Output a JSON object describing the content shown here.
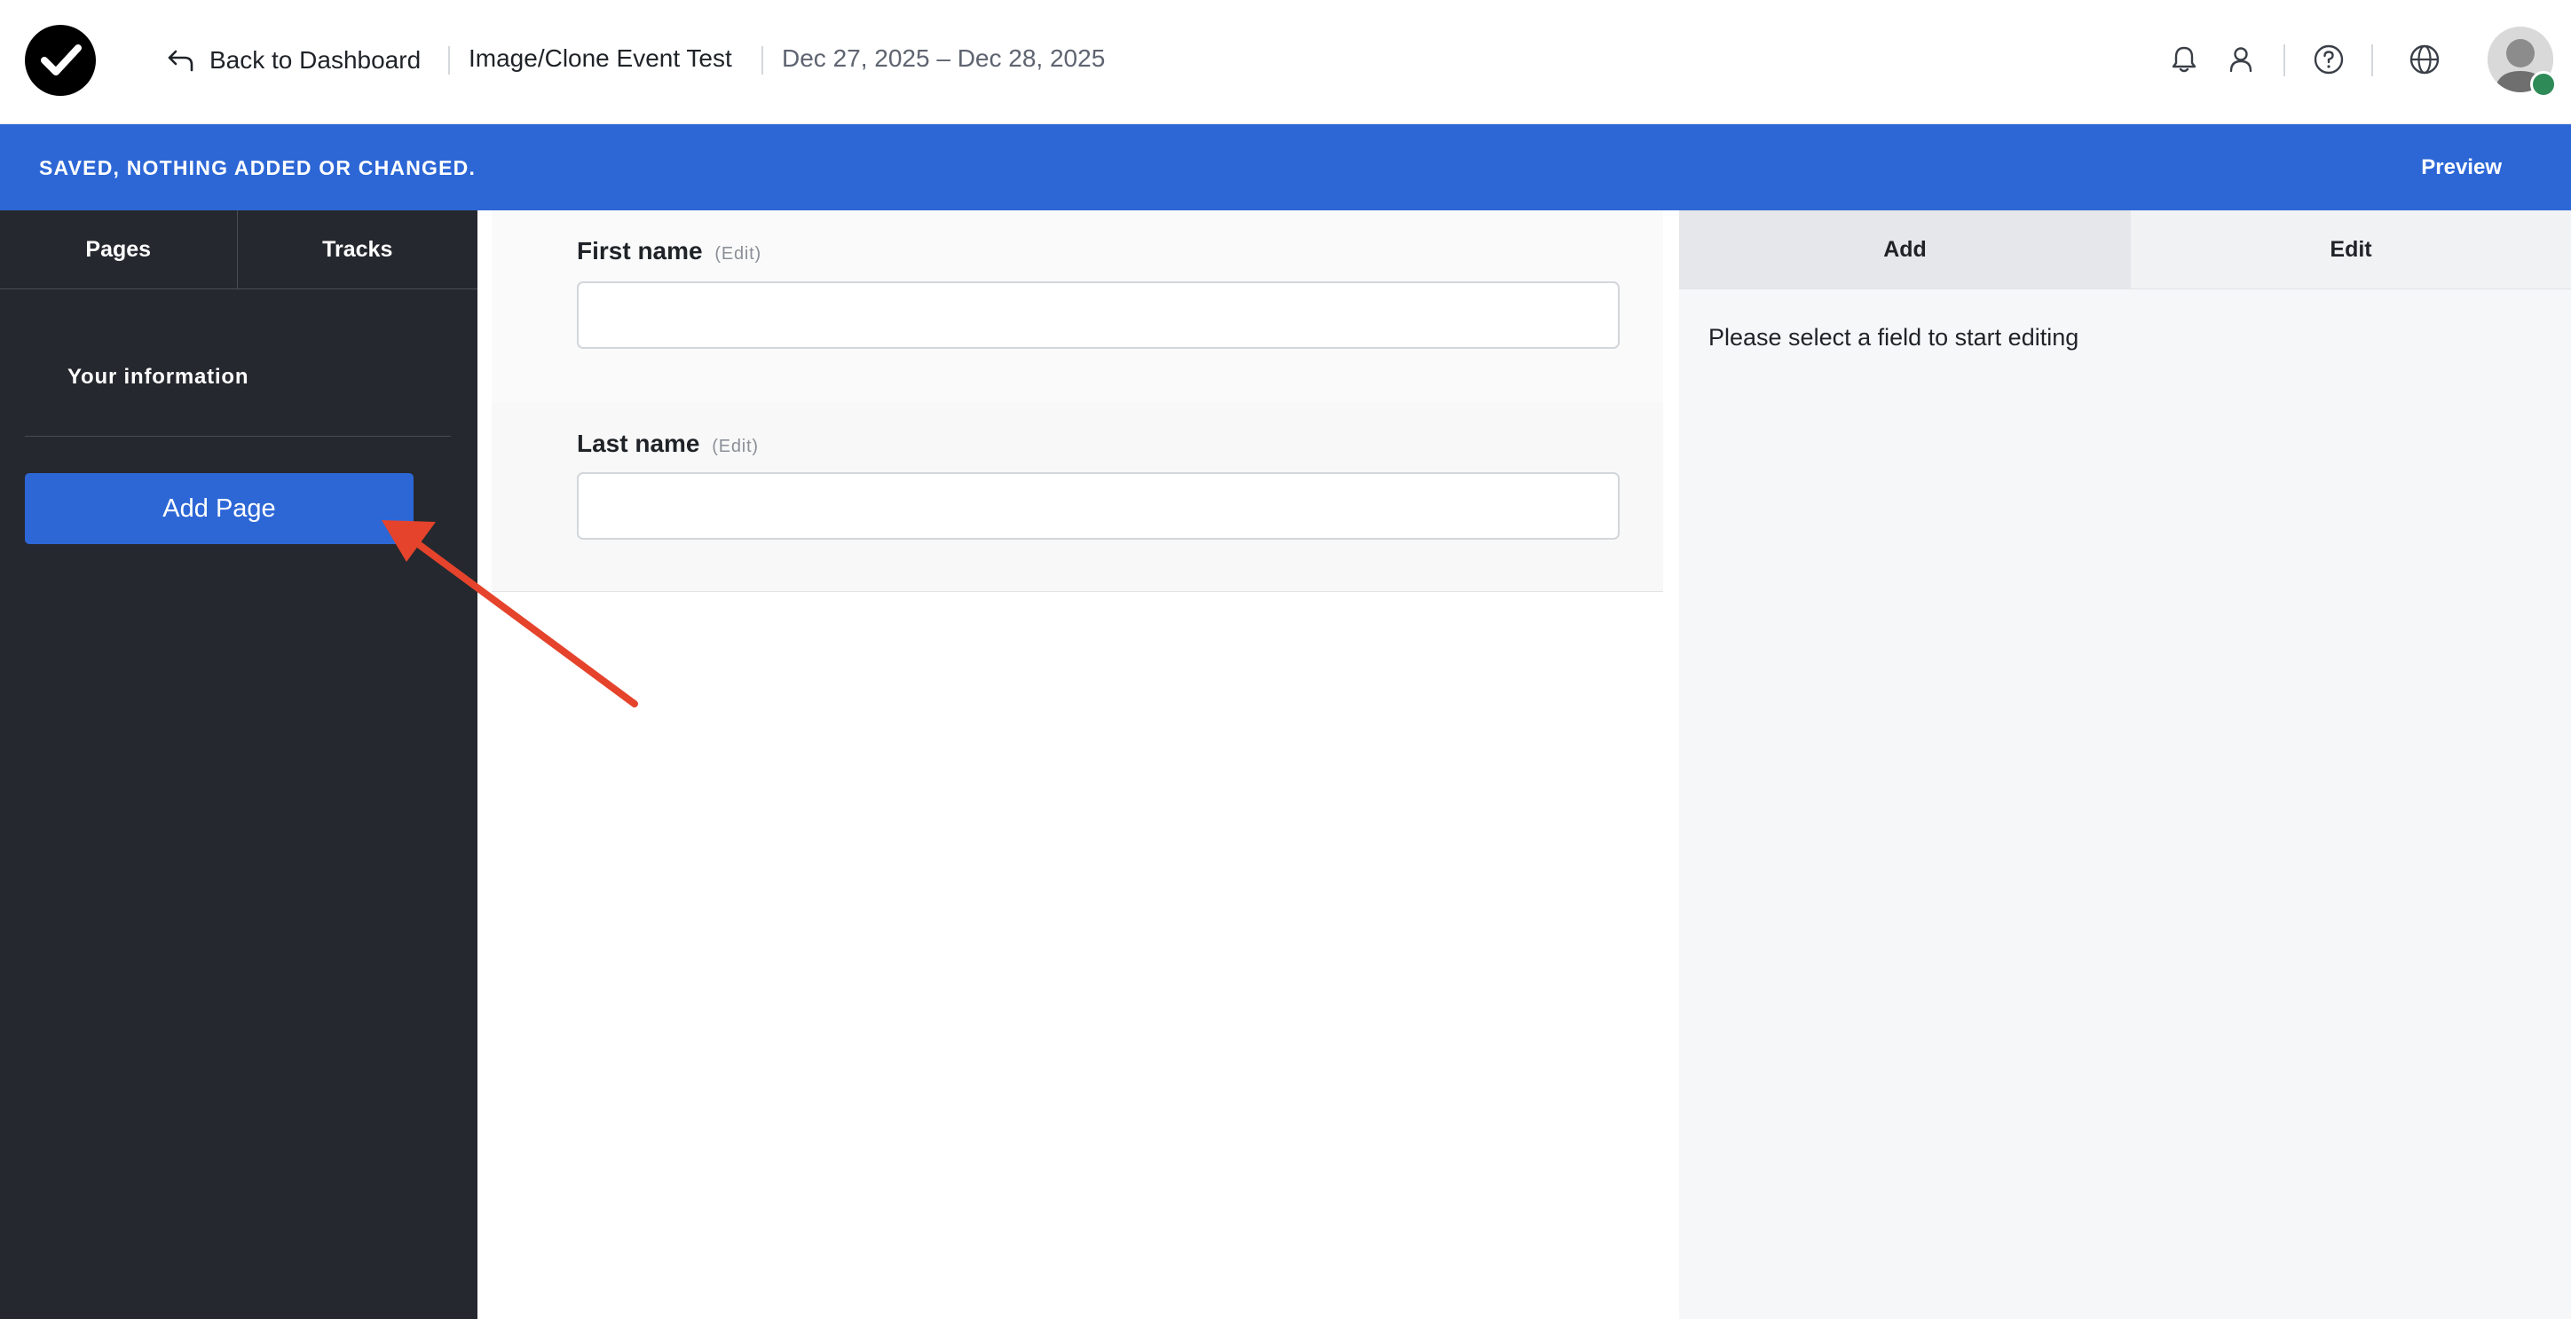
{
  "header": {
    "back_label": "Back to Dashboard",
    "event_title": "Image/Clone Event Test",
    "event_dates": "Dec 27, 2025 – Dec 28, 2025",
    "icons": [
      "bell-icon",
      "user-icon",
      "help-icon",
      "globe-icon"
    ]
  },
  "status": {
    "message": "SAVED, NOTHING ADDED OR CHANGED.",
    "preview_label": "Preview"
  },
  "sidebar": {
    "tabs": [
      {
        "label": "Pages"
      },
      {
        "label": "Tracks"
      }
    ],
    "pages": [
      {
        "label": "Your information"
      }
    ],
    "add_page_label": "Add Page"
  },
  "form": {
    "fields": [
      {
        "label": "First name",
        "edit_label": "(Edit)",
        "value": ""
      },
      {
        "label": "Last name",
        "edit_label": "(Edit)",
        "value": ""
      }
    ]
  },
  "right_panel": {
    "tabs": [
      {
        "label": "Add"
      },
      {
        "label": "Edit"
      }
    ],
    "empty_message": "Please select a field to start editing"
  },
  "colors": {
    "accent": "#2d67d6",
    "sidebar_bg": "#25282e",
    "annotation_arrow": "#e5432c"
  }
}
